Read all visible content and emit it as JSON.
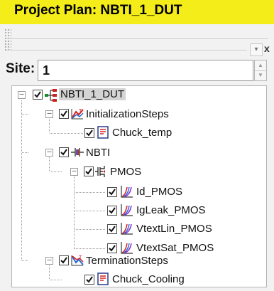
{
  "window": {
    "title": "Project Plan: NBTI_1_DUT"
  },
  "panel": {
    "close_glyph": "x"
  },
  "site": {
    "label": "Site:",
    "value": "1"
  },
  "tree": {
    "root": "NBTI_1_DUT",
    "initialization": "InitializationSteps",
    "chuck_temp": "Chuck_temp",
    "nbti": "NBTI",
    "pmos": "PMOS",
    "id_pmos": "Id_PMOS",
    "igleak_pmos": "IgLeak_PMOS",
    "vtextlin_pmos": "VtextLin_PMOS",
    "vtextsat_pmos": "VtextSat_PMOS",
    "termination": "TerminationSteps",
    "chuck_cooling": "Chuck_Cooling"
  },
  "colors": {
    "title_bar": "#f5ed1a",
    "selection": "#d4d4d4"
  },
  "icons": [
    "minus-expander-icon",
    "checkbox-checked-icon",
    "project-hierarchy-icon",
    "init-steps-icon",
    "script-doc-icon",
    "nbti-icon",
    "pmos-device-icon",
    "measurement-plot-icon",
    "termination-steps-icon"
  ]
}
